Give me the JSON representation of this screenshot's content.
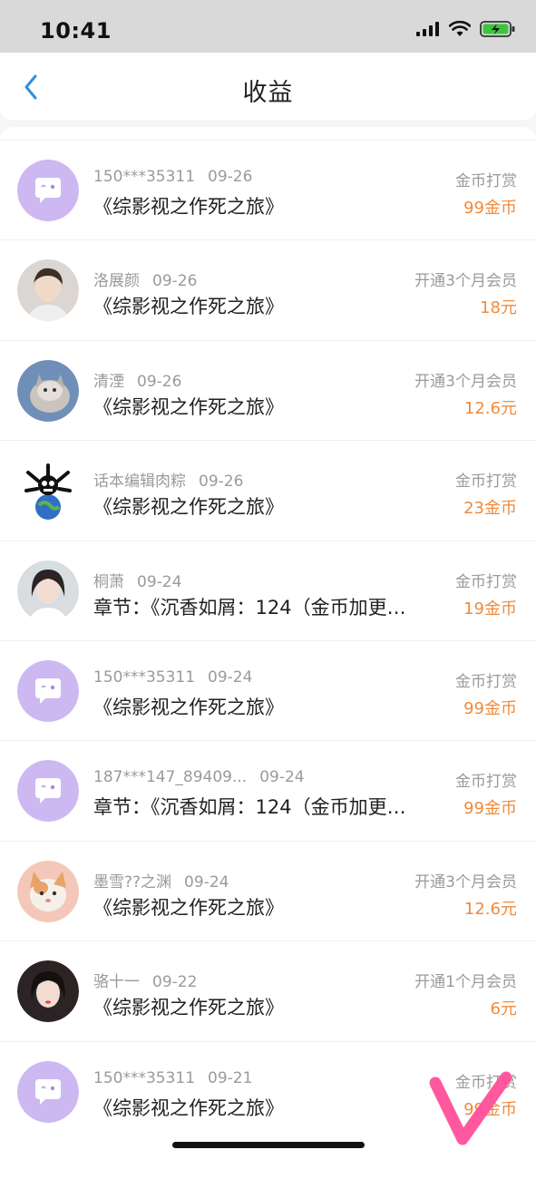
{
  "status_bar": {
    "time": "10:41"
  },
  "nav": {
    "title": "收益"
  },
  "items": [
    {
      "user": "150***35311",
      "date": "09-26",
      "book": "《综影视之作死之旅》",
      "type": "金币打赏",
      "amount": "99金币",
      "avatar": "default-chat-avatar"
    },
    {
      "user": "洛展颜",
      "date": "09-26",
      "book": "《综影视之作死之旅》",
      "type": "开通3个月会员",
      "amount": "18元",
      "avatar": "user-photo-avatar"
    },
    {
      "user": "清湮",
      "date": "09-26",
      "book": "《综影视之作死之旅》",
      "type": "开通3个月会员",
      "amount": "12.6元",
      "avatar": "cat-photo-avatar"
    },
    {
      "user": "话本编辑肉粽",
      "date": "09-26",
      "book": "《综影视之作死之旅》",
      "type": "金币打赏",
      "amount": "23金币",
      "avatar": "cartoon-avatar"
    },
    {
      "user": "桐萧",
      "date": "09-24",
      "book": "章节：《沉香如屑：124（金币加更…",
      "type": "金币打赏",
      "amount": "19金币",
      "avatar": "user-photo-avatar"
    },
    {
      "user": "150***35311",
      "date": "09-24",
      "book": "《综影视之作死之旅》",
      "type": "金币打赏",
      "amount": "99金币",
      "avatar": "default-chat-avatar"
    },
    {
      "user": "187***147_89409...",
      "date": "09-24",
      "book": "章节：《沉香如屑：124（金币加更…",
      "type": "金币打赏",
      "amount": "99金币",
      "avatar": "default-chat-avatar"
    },
    {
      "user": "墨雪??之渊",
      "date": "09-24",
      "book": "《综影视之作死之旅》",
      "type": "开通3个月会员",
      "amount": "12.6元",
      "avatar": "cat-photo-avatar"
    },
    {
      "user": "骆十一",
      "date": "09-22",
      "book": "《综影视之作死之旅》",
      "type": "开通1个月会员",
      "amount": "6元",
      "avatar": "user-photo-avatar"
    },
    {
      "user": "150***35311",
      "date": "09-21",
      "book": "《综影视之作死之旅》",
      "type": "金币打赏",
      "amount": "99金币",
      "avatar": "default-chat-avatar"
    }
  ],
  "colors": {
    "accent_blue": "#2f8fe0",
    "amount_orange": "#f08a3a",
    "avatar_purple": "#cdb8f2",
    "check_pink": "#ff4f9a"
  }
}
